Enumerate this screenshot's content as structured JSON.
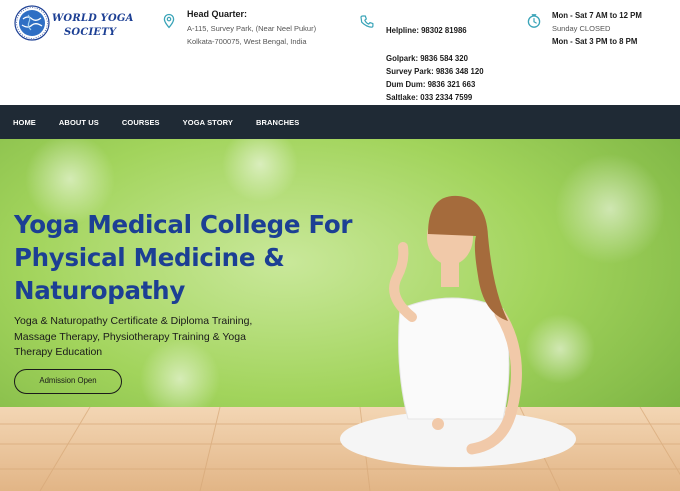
{
  "brand": {
    "name_line1": "WORLD YOGA",
    "name_line2": "SOCIETY",
    "logo_icon": "globe-logo-icon"
  },
  "head_quarter": {
    "icon": "location-pin-icon",
    "title": "Head Quarter:",
    "lines": [
      "A-115, Survey Park, (Near Neel Pukur)",
      "Kolkata-700075, West Bengal, India"
    ]
  },
  "contact": {
    "icon": "phone-icon",
    "helpline": "Helpline: 98302 81986",
    "branches": [
      "Golpark: 9836 584 320",
      "Survey Park: 9836 348 120",
      "Dum Dum: 9836 321 663",
      "Saltlake: 033 2334 7599"
    ]
  },
  "hours": {
    "icon": "clock-icon",
    "line1": "Mon - Sat 7 AM to 12 PM",
    "line2": "Sunday CLOSED",
    "line3": "Mon - Sat 3 PM to 8 PM"
  },
  "nav": {
    "items": [
      "HOME",
      "ABOUT US",
      "COURSES",
      "YOGA STORY",
      "BRANCHES"
    ]
  },
  "hero": {
    "title_line1": "Yoga Medical College For",
    "title_line2": "Physical Medicine &",
    "title_line3": "Naturopathy",
    "subtitle": "Yoga & Naturopathy Certificate & Diploma Training, Massage Therapy, Physiotherapy Training & Yoga Therapy Education",
    "button_label": "Admission Open"
  },
  "colors": {
    "brand_blue": "#1c3f94",
    "nav_bg": "#1f2a35",
    "icon_teal": "#3aa4b8",
    "hero_green": "#8cc63f"
  }
}
